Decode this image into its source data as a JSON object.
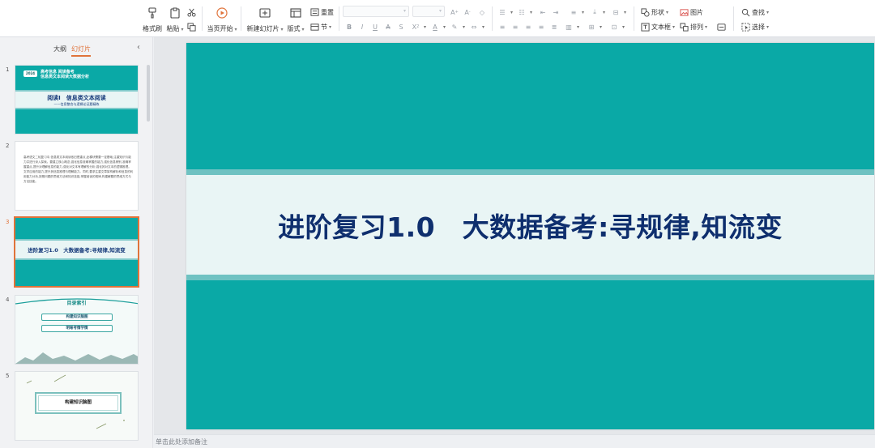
{
  "ribbon": {
    "clipboard": {
      "format_painter": "格式刷",
      "paste": "粘贴"
    },
    "start_slideshow": "当页开始",
    "slides_group": {
      "new_slide": "新建幻灯片",
      "layout": "版式",
      "reset": "重置",
      "section": "节"
    },
    "drawing": {
      "shape": "形状",
      "textbox": "文本框",
      "picture": "图片",
      "arrange": "排列"
    },
    "editing": {
      "find": "查找",
      "select": "选择"
    }
  },
  "left_pane": {
    "tabs": [
      "大纲",
      "幻灯片"
    ],
    "active_tab": "幻灯片",
    "thumbnails": [
      {
        "number": "1",
        "badge": "2024",
        "heading_line1": "高考信息 阅读备考",
        "heading_line2": "信息类文本阅读大数据分析",
        "title": "阅读Ⅰ　信息类文本阅读",
        "subtitle": "——信息整合与逻辑论证题精练"
      },
      {
        "number": "2",
        "text": "高考语文二轮复习中,信息类文本阅读依旧是重点,此模块需要一定基础,注重知识与能力并进行深入探索。要建立核心概念,强化信息准确掌握的能力,强化信息辨别,准确掌握重点,提升对理解信息的能力,强化对文本有理解的分析,强化其对文本的逻辑推理。文学应用的能力,提升其信息推理与理解能力。同时,要求注重文章架构解析和信息的利用能力分析,按照问题的思维方法和知识技能,掌握阅读的规律,构建解题的思维方式与方法技能。"
      },
      {
        "number": "3",
        "title": "进阶复习1.0　大数据备考:寻规律,知流变"
      },
      {
        "number": "4",
        "title": "目录索引",
        "items": [
          "构建知识脑图",
          "明晰考情学情"
        ]
      },
      {
        "number": "5",
        "title": "构建知识脑图"
      }
    ],
    "active_slide": "3"
  },
  "slide": {
    "title": "进阶复习1.0　大数据备考:寻规律,知流变"
  },
  "notes_placeholder": "单击此处添加备注",
  "colors": {
    "slide_teal": "#0aa9a6",
    "slide_band": "#e9f5f5",
    "slide_stripe": "#6fc2c2",
    "title_navy": "#0f2f6e",
    "accent_orange": "#e0733a"
  }
}
